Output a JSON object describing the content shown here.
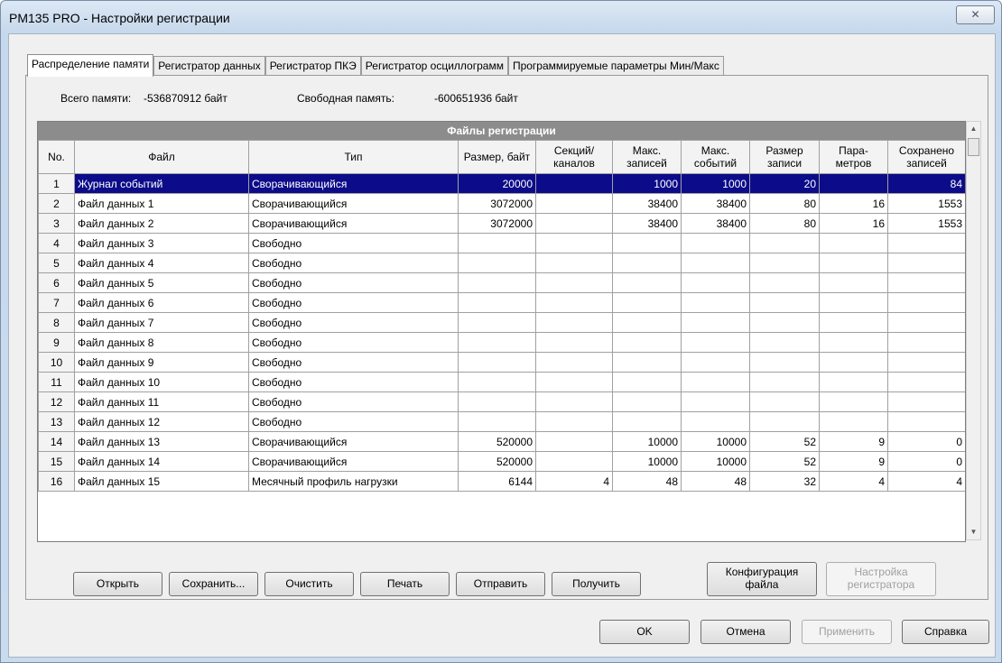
{
  "window": {
    "title": "PM135 PRO - Настройки регистрации",
    "close_glyph": "✕"
  },
  "tabs": [
    {
      "label": "Распределение памяти"
    },
    {
      "label": "Регистратор данных"
    },
    {
      "label": "Регистратор ПКЭ"
    },
    {
      "label": "Регистратор осциллограмм"
    },
    {
      "label": "Программируемые параметры Мин/Макс"
    }
  ],
  "memory": {
    "total_label": "Всего памяти:",
    "total_value": "-536870912 байт",
    "free_label": "Свободная память:",
    "free_value": "-600651936 байт"
  },
  "grid": {
    "title": "Файлы регистрации",
    "headers": [
      "No.",
      "Файл",
      "Тип",
      "Размер, байт",
      "Секций/ каналов",
      "Макс. записей",
      "Макс. событий",
      "Размер записи",
      "Пара- метров",
      "Сохранено записей"
    ],
    "rows": [
      [
        "1",
        "Журнал событий",
        "Сворачивающийся",
        "20000",
        "",
        "1000",
        "1000",
        "20",
        "",
        "84"
      ],
      [
        "2",
        "Файл данных 1",
        "Сворачивающийся",
        "3072000",
        "",
        "38400",
        "38400",
        "80",
        "16",
        "1553"
      ],
      [
        "3",
        "Файл данных 2",
        "Сворачивающийся",
        "3072000",
        "",
        "38400",
        "38400",
        "80",
        "16",
        "1553"
      ],
      [
        "4",
        "Файл данных 3",
        "Свободно",
        "",
        "",
        "",
        "",
        "",
        "",
        ""
      ],
      [
        "5",
        "Файл данных 4",
        "Свободно",
        "",
        "",
        "",
        "",
        "",
        "",
        ""
      ],
      [
        "6",
        "Файл данных 5",
        "Свободно",
        "",
        "",
        "",
        "",
        "",
        "",
        ""
      ],
      [
        "7",
        "Файл данных 6",
        "Свободно",
        "",
        "",
        "",
        "",
        "",
        "",
        ""
      ],
      [
        "8",
        "Файл данных 7",
        "Свободно",
        "",
        "",
        "",
        "",
        "",
        "",
        ""
      ],
      [
        "9",
        "Файл данных 8",
        "Свободно",
        "",
        "",
        "",
        "",
        "",
        "",
        ""
      ],
      [
        "10",
        "Файл данных 9",
        "Свободно",
        "",
        "",
        "",
        "",
        "",
        "",
        ""
      ],
      [
        "11",
        "Файл данных 10",
        "Свободно",
        "",
        "",
        "",
        "",
        "",
        "",
        ""
      ],
      [
        "12",
        "Файл данных 11",
        "Свободно",
        "",
        "",
        "",
        "",
        "",
        "",
        ""
      ],
      [
        "13",
        "Файл данных 12",
        "Свободно",
        "",
        "",
        "",
        "",
        "",
        "",
        ""
      ],
      [
        "14",
        "Файл данных 13",
        "Сворачивающийся",
        "520000",
        "",
        "10000",
        "10000",
        "52",
        "9",
        "0"
      ],
      [
        "15",
        "Файл данных 14",
        "Сворачивающийся",
        "520000",
        "",
        "10000",
        "10000",
        "52",
        "9",
        "0"
      ],
      [
        "16",
        "Файл данных 15",
        "Месячный профиль нагрузки",
        "6144",
        "4",
        "48",
        "48",
        "32",
        "4",
        "4"
      ]
    ],
    "selected_row": 0
  },
  "actions": {
    "open": "Открыть",
    "save": "Сохранить...",
    "clear": "Очистить",
    "print": "Печать",
    "send": "Отправить",
    "receive": "Получить",
    "file_config_1": "Конфигурация",
    "file_config_2": "файла",
    "logger_setup_1": "Настройка",
    "logger_setup_2": "регистратора"
  },
  "dialog": {
    "ok": "OK",
    "cancel": "Отмена",
    "apply": "Применить",
    "help": "Справка"
  }
}
